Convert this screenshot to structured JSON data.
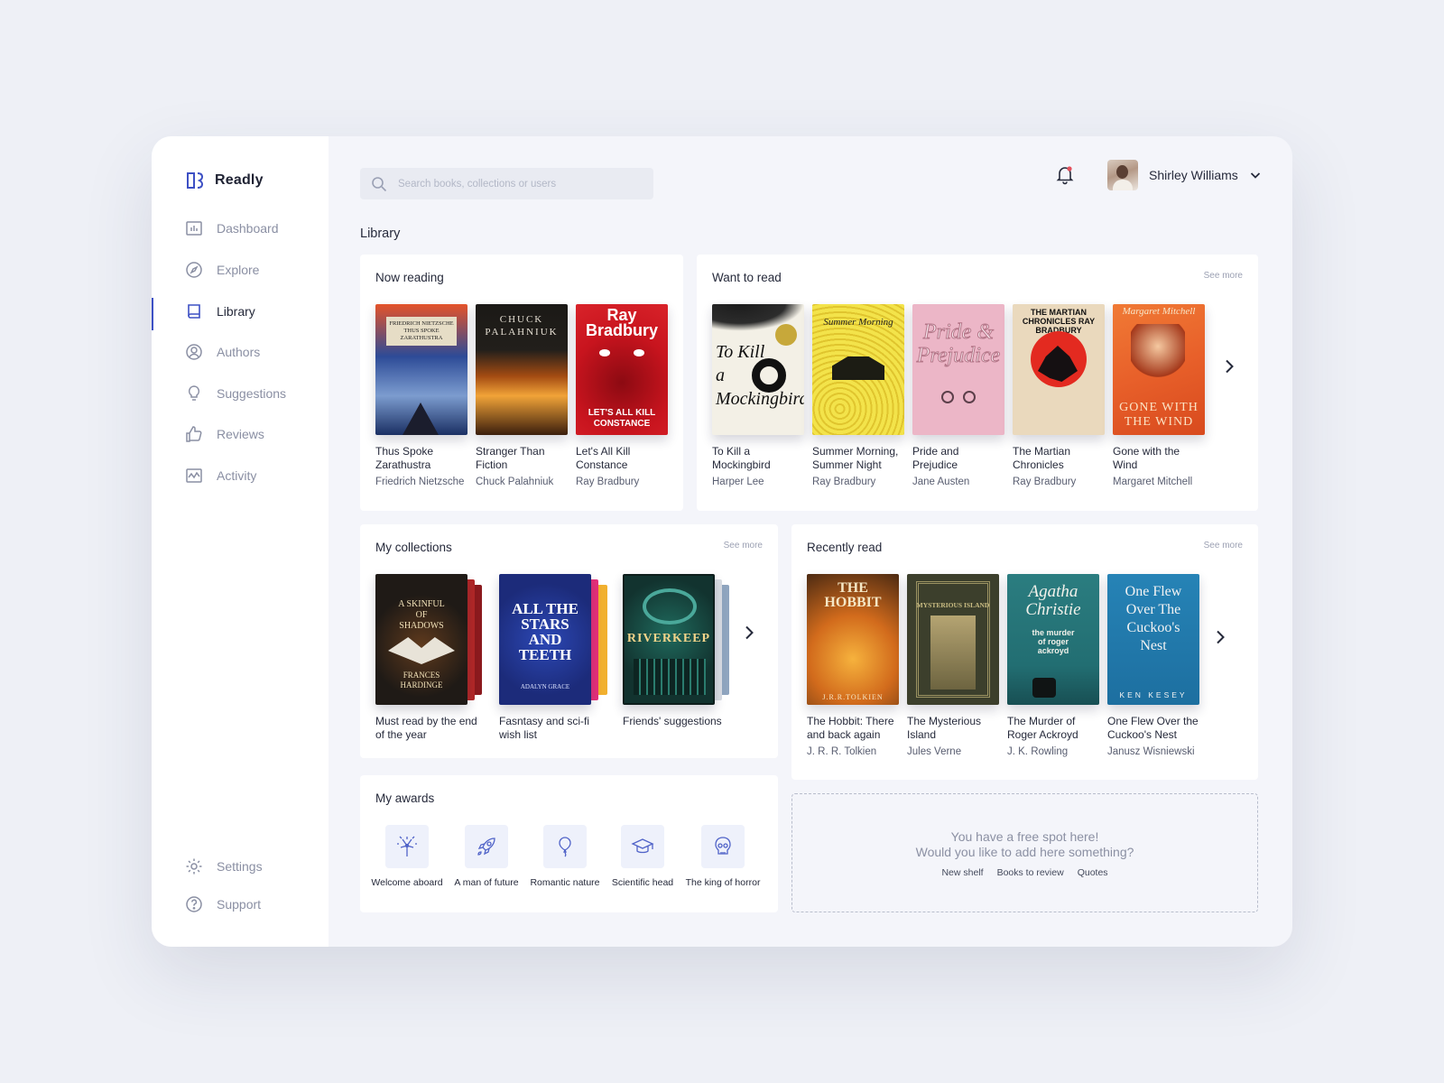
{
  "app": {
    "name": "Readly",
    "accent": "#3d50c4"
  },
  "sidebar": {
    "items": [
      {
        "label": "Dashboard",
        "icon": "chart-icon"
      },
      {
        "label": "Explore",
        "icon": "compass-icon"
      },
      {
        "label": "Library",
        "icon": "book-icon",
        "active": true
      },
      {
        "label": "Authors",
        "icon": "user-circle-icon"
      },
      {
        "label": "Suggestions",
        "icon": "lightbulb-icon"
      },
      {
        "label": "Reviews",
        "icon": "thumbs-up-icon"
      },
      {
        "label": "Activity",
        "icon": "activity-icon"
      }
    ],
    "bottom": [
      {
        "label": "Settings",
        "icon": "gear-icon"
      },
      {
        "label": "Support",
        "icon": "help-icon"
      }
    ]
  },
  "header": {
    "search_placeholder": "Search books, collections or users",
    "user_name": "Shirley Williams"
  },
  "page_title": "Library",
  "now_reading": {
    "title": "Now reading",
    "books": [
      {
        "title": "Thus Spoke Zarathustra",
        "author": "Friedrich Nietzsche",
        "cover_color": "#3b5da8",
        "cover_text": "FRIEDRICH NIETZSCHE THUS SPOKE ZARATHUSTRA"
      },
      {
        "title": "Stranger Than Fiction",
        "author": "Chuck Palahniuk",
        "cover_color": "#1c1a18",
        "cover_text": "CHUCK PALAHNIUK"
      },
      {
        "title": "Let's All Kill Constance",
        "author": "Ray Bradbury",
        "cover_color": "#c8141e",
        "cover_text": "Ray Bradbury",
        "cover_sub": "LET'S ALL KILL CONSTANCE"
      }
    ]
  },
  "want_to_read": {
    "title": "Want to read",
    "see_more": "See more",
    "books": [
      {
        "title": "To Kill a Mockingbird",
        "author": "Harper Lee",
        "cover_color": "#f3f0e6",
        "cover_text": "To Kill a Mockingbird"
      },
      {
        "title": "Summer Morning, Summer Night",
        "author": "Ray Bradbury",
        "cover_color": "#f4e44a",
        "cover_text": "Summer Morning"
      },
      {
        "title": "Pride and Prejudice",
        "author": "Jane Austen",
        "cover_color": "#ecb6c7",
        "cover_text": "Pride & Prejudice"
      },
      {
        "title": "The Martian Chronicles",
        "author": "Ray Bradbury",
        "cover_color": "#ead9bd",
        "cover_text": "THE MARTIAN CHRONICLES RAY BRADBURY"
      },
      {
        "title": "Gone with the Wind",
        "author": "Margaret Mitchell",
        "cover_color": "#e8602a",
        "cover_text": "GONE WITH THE WIND",
        "cover_sub": "Margaret Mitchell"
      }
    ]
  },
  "collections": {
    "title": "My collections",
    "see_more": "See more",
    "items": [
      {
        "label": "Must read by the end of the year",
        "cover_color": "#1f1a16",
        "cover_text": "A SKINFUL OF SHADOWS",
        "cover_sub": "FRANCES HARDINGE"
      },
      {
        "label": "Fasntasy and sci-fi wish list",
        "cover_color": "#1c2b7a",
        "cover_text": "ALL THE STARS AND TEETH",
        "cover_sub": "ADALYN GRACE"
      },
      {
        "label": "Friends' suggestions",
        "cover_color": "#12332f",
        "cover_text": "RIVERKEEP"
      }
    ]
  },
  "recently_read": {
    "title": "Recently read",
    "see_more": "See more",
    "books": [
      {
        "title": "The Hobbit: There and back again",
        "author": "J. R. R. Tolkien",
        "cover_color": "#d26b1c",
        "cover_text": "THE HOBBIT",
        "cover_sub": "J.R.R.TOLKIEN"
      },
      {
        "title": "The Mysterious Island",
        "author": "Jules Verne",
        "cover_color": "#3c3f2c",
        "cover_text": "MYSTERIOUS ISLAND"
      },
      {
        "title": "The Murder of Roger Ackroyd",
        "author": "J. K. Rowling",
        "cover_color": "#226e72",
        "cover_text": "Agatha Christie",
        "cover_sub": "the murder of roger ackroyd"
      },
      {
        "title": "One Flew Over the Cuckoo's Nest",
        "author": "Janusz Wisniewski",
        "cover_color": "#1d6fa0",
        "cover_text": "One Flew Over The Cuckoo's Nest",
        "cover_sub": "KEN KESEY"
      }
    ]
  },
  "awards": {
    "title": "My awards",
    "items": [
      {
        "label": "Welcome aboard",
        "icon": "fireworks-icon"
      },
      {
        "label": "A man of future",
        "icon": "rocket-icon"
      },
      {
        "label": "Romantic nature",
        "icon": "balloon-icon"
      },
      {
        "label": "Scientific head",
        "icon": "graduation-cap-icon"
      },
      {
        "label": "The king of horror",
        "icon": "skull-icon"
      }
    ]
  },
  "free_spot": {
    "line1": "You have a free spot here!",
    "line2": "Would you like to add here something?",
    "links": [
      "New shelf",
      "Books to review",
      "Quotes"
    ]
  }
}
